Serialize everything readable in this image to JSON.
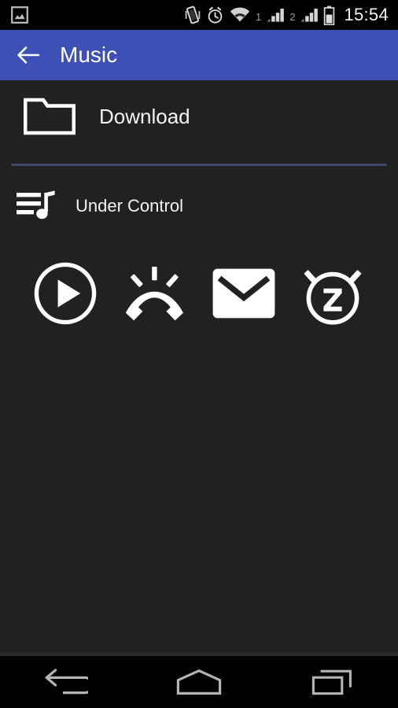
{
  "status_bar": {
    "background": "#000000",
    "time": "15:54",
    "left_icons": [
      {
        "name": "photo-notification-icon",
        "glyph": "picture-frame"
      }
    ],
    "right_icons": [
      {
        "name": "vibrate-icon",
        "glyph": "phone-vibrate"
      },
      {
        "name": "alarm-set-icon",
        "glyph": "alarm-clock"
      },
      {
        "name": "wifi-icon",
        "glyph": "wifi-signal"
      },
      {
        "name": "sim1-label",
        "glyph": "text",
        "text": "1"
      },
      {
        "name": "signal-bars-sim1-icon",
        "glyph": "signal-bars"
      },
      {
        "name": "sim2-label",
        "glyph": "text",
        "text": "2"
      },
      {
        "name": "signal-bars-sim2-icon",
        "glyph": "signal-bars"
      },
      {
        "name": "battery-icon",
        "glyph": "battery-half"
      }
    ]
  },
  "app_bar": {
    "title": "Music",
    "background": "#3d50b5",
    "back_icon": "arrow-left-icon"
  },
  "content": {
    "background": "#212121",
    "folder_item": {
      "label": "Download",
      "icon": "folder-icon"
    },
    "divider_color": "#3f4670",
    "song_item": {
      "label": "Under Control",
      "icon": "music-playlist-icon"
    },
    "actions": [
      {
        "name": "play-button",
        "icon": "play-circle-icon",
        "label": "Play"
      },
      {
        "name": "set-ringtone-button",
        "icon": "ringtone-icon",
        "label": "Ringtone"
      },
      {
        "name": "set-notification-button",
        "icon": "envelope-icon",
        "label": "Notification"
      },
      {
        "name": "set-alarm-button",
        "icon": "alarm-snooze-icon",
        "label": "Alarm"
      }
    ]
  },
  "nav_bar": {
    "background": "#000000",
    "buttons": [
      {
        "name": "nav-back-button",
        "icon": "nav-back-icon",
        "label": "Back"
      },
      {
        "name": "nav-home-button",
        "icon": "nav-home-icon",
        "label": "Home"
      },
      {
        "name": "nav-recents-button",
        "icon": "nav-recents-icon",
        "label": "Recents"
      }
    ]
  }
}
